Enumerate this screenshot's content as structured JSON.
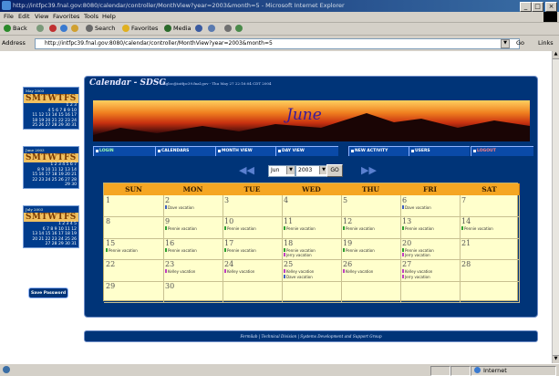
{
  "window": {
    "title": "http://intfpc39.fnal.gov:8080/calendar/controller/MonthView?year=2003&month=5 - Microsoft Internet Explorer",
    "minimize": "_",
    "maximize": "□",
    "close": "×"
  },
  "menubar": {
    "items": [
      "File",
      "Edit",
      "View",
      "Favorites",
      "Tools",
      "Help"
    ]
  },
  "toolbar": {
    "back": "Back",
    "search": "Search",
    "favorites": "Favorites",
    "media": "Media"
  },
  "address": {
    "label": "Address",
    "url": "http://intfpc39.fnal.gov:8080/calendar/controller/MonthView?year=2003&month=5",
    "go": "Go",
    "links": "Links"
  },
  "statusbar": {
    "zone": "Internet"
  },
  "minicals": [
    {
      "title": "May 2003",
      "header": "SMTWTFS",
      "weeks": [
        "1 2 3",
        "4 5 6 7 8 9 10",
        "11 12 13 14 15 16 17",
        "18 19 20 21 22 23 24",
        "25 26 27 28 29 30 31"
      ]
    },
    {
      "title": "June 2003",
      "header": "SMTWTFS",
      "weeks": [
        "1 2 3 4 5 6 7",
        "8 9 10 11 12 13 14",
        "15 16 17 18 19 20 21",
        "22 23 24 25 26 27 28",
        "29 30"
      ]
    },
    {
      "title": "July 2003",
      "header": "SMTWTFS",
      "weeks": [
        "1 2 3 4 5",
        "6 7 8 9 10 11 12",
        "13 14 15 16 17 18 19",
        "20 21 22 23 24 25 26",
        "27 28 29 30 31"
      ]
    }
  ],
  "save_password": "Save Password",
  "app": {
    "title": "Calendar - SDSG",
    "subtitle": "tsgloc@intfpc39.fnal.gov - Thu May 27 22:16:04 CDT 2004",
    "banner_month": "June"
  },
  "nav": [
    "LOGIN",
    "CALENDARS",
    "MONTH VIEW",
    "DAY VIEW",
    "NEW ACTIVITY",
    "USERS",
    "LOGOUT"
  ],
  "picker": {
    "month": "Jun",
    "year": "2003",
    "go": "GO",
    "prev": "◀◀",
    "next": "▶▶"
  },
  "calendar": {
    "days_of_week": [
      "SUN",
      "MON",
      "TUE",
      "WED",
      "THU",
      "FRI",
      "SAT"
    ],
    "weeks": [
      [
        {
          "d": "1",
          "ev": []
        },
        {
          "d": "2",
          "ev": [
            {
              "t": "Dave vacation",
              "c": "#4060c0"
            }
          ]
        },
        {
          "d": "3",
          "ev": []
        },
        {
          "d": "4",
          "ev": []
        },
        {
          "d": "5",
          "ev": []
        },
        {
          "d": "6",
          "ev": [
            {
              "t": "Dave vacation",
              "c": "#4060c0"
            }
          ]
        },
        {
          "d": "7",
          "ev": []
        }
      ],
      [
        {
          "d": "8",
          "ev": []
        },
        {
          "d": "9",
          "ev": [
            {
              "t": "Pennie vacation",
              "c": "#30a030"
            }
          ]
        },
        {
          "d": "10",
          "ev": [
            {
              "t": "Pennie vacation",
              "c": "#30a030"
            }
          ]
        },
        {
          "d": "11",
          "ev": [
            {
              "t": "Pennie vacation",
              "c": "#30a030"
            }
          ]
        },
        {
          "d": "12",
          "ev": [
            {
              "t": "Pennie vacation",
              "c": "#30a030"
            }
          ]
        },
        {
          "d": "13",
          "ev": [
            {
              "t": "Pennie vacation",
              "c": "#30a030"
            }
          ]
        },
        {
          "d": "14",
          "ev": [
            {
              "t": "Pennie vacation",
              "c": "#30a030"
            }
          ]
        }
      ],
      [
        {
          "d": "15",
          "ev": [
            {
              "t": "Pennie vacation",
              "c": "#30a030"
            }
          ]
        },
        {
          "d": "16",
          "ev": [
            {
              "t": "Pennie vacation",
              "c": "#30a030"
            }
          ]
        },
        {
          "d": "17",
          "ev": [
            {
              "t": "Pennie vacation",
              "c": "#30a030"
            }
          ]
        },
        {
          "d": "18",
          "ev": [
            {
              "t": "Pennie vacation",
              "c": "#30a030"
            },
            {
              "t": "Jerry vacation",
              "c": "#c040c0"
            }
          ]
        },
        {
          "d": "19",
          "ev": [
            {
              "t": "Pennie vacation",
              "c": "#30a030"
            }
          ]
        },
        {
          "d": "20",
          "ev": [
            {
              "t": "Pennie vacation",
              "c": "#30a030"
            },
            {
              "t": "Jerry vacation",
              "c": "#c040c0"
            }
          ]
        },
        {
          "d": "21",
          "ev": []
        }
      ],
      [
        {
          "d": "22",
          "ev": []
        },
        {
          "d": "23",
          "ev": [
            {
              "t": "Kelley vacation",
              "c": "#c040c0"
            }
          ]
        },
        {
          "d": "24",
          "ev": [
            {
              "t": "Kelley vacation",
              "c": "#c040c0"
            }
          ]
        },
        {
          "d": "25",
          "ev": [
            {
              "t": "Kelley vacation",
              "c": "#c040c0"
            },
            {
              "t": "Dave vacation",
              "c": "#4060c0"
            }
          ]
        },
        {
          "d": "26",
          "ev": [
            {
              "t": "Kelley vacation",
              "c": "#c040c0"
            }
          ]
        },
        {
          "d": "27",
          "ev": [
            {
              "t": "Kelley vacation",
              "c": "#c040c0"
            },
            {
              "t": "Jerry vacation",
              "c": "#c040c0"
            }
          ]
        },
        {
          "d": "28",
          "ev": []
        }
      ],
      [
        {
          "d": "29",
          "ev": []
        },
        {
          "d": "30",
          "ev": []
        },
        {
          "d": "",
          "ev": []
        },
        {
          "d": "",
          "ev": []
        },
        {
          "d": "",
          "ev": []
        },
        {
          "d": "",
          "ev": []
        },
        {
          "d": "",
          "ev": []
        }
      ]
    ]
  },
  "footer": "Fermilab | Technical Division | Systems Development and Support Group"
}
